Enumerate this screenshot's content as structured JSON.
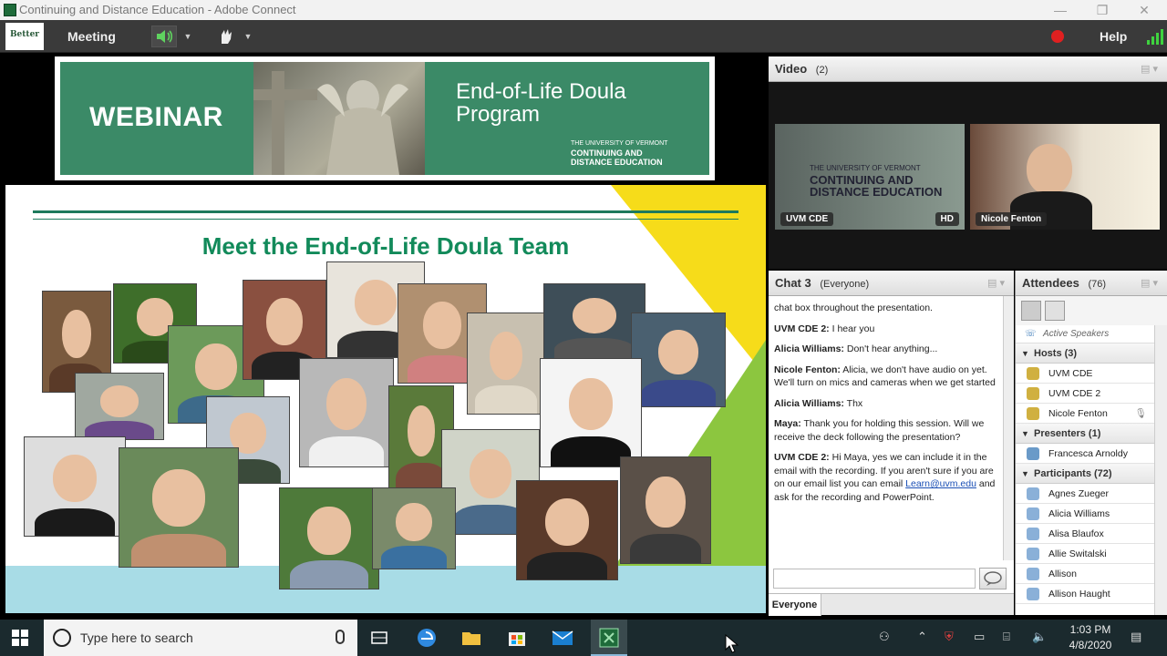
{
  "window": {
    "title": "Continuing and Distance Education - Adobe Connect",
    "minimize_glyph": "—",
    "restore_glyph": "❐",
    "close_glyph": "✕"
  },
  "menubar": {
    "logo_text": "Better",
    "meeting_label": "Meeting",
    "help_label": "Help",
    "icons": [
      "speaker-icon",
      "raise-hand-icon",
      "record-icon",
      "signal-icon"
    ]
  },
  "banner": {
    "webinar": "WEBINAR",
    "title_line1": "End-of-Life Doula",
    "title_line2": "Program",
    "uvm_line1": "THE UNIVERSITY OF VERMONT",
    "uvm_line2": "CONTINUING AND",
    "uvm_line3": "DISTANCE EDUCATION"
  },
  "slide": {
    "heading": "Meet the End-of-Life Doula Team"
  },
  "video_pod": {
    "title": "Video",
    "count": "(2)",
    "feeds": [
      {
        "label": "UVM CDE",
        "badge": "HD",
        "logo_line1": "THE UNIVERSITY OF VERMONT",
        "logo_line2": "CONTINUING AND",
        "logo_line3": "DISTANCE EDUCATION"
      },
      {
        "label": "Nicole Fenton"
      }
    ]
  },
  "chat_pod": {
    "title": "Chat 3",
    "scope": "(Everyone)",
    "messages": [
      {
        "sender": "",
        "text": "chat box throughout the presentation."
      },
      {
        "sender": "UVM CDE 2:",
        "text": " I hear you"
      },
      {
        "sender": "Alicia Williams:",
        "text": " Don't hear anything..."
      },
      {
        "sender": "Nicole Fenton:",
        "text": " Alicia, we don't have audio on yet. We'll turn on mics and cameras when we get started"
      },
      {
        "sender": "Alicia Williams:",
        "text": " Thx"
      },
      {
        "sender": "Maya:",
        "text": " Thank you for holding this session. Will we receive the deck following the presentation?"
      },
      {
        "sender": "UVM CDE 2:",
        "text": " Hi Maya, yes we can include it in the email with the recording. If you aren't sure if you are on our email list you can email ",
        "link": "Learn@uvm.edu",
        "after": " and ask for the recording and PowerPoint."
      }
    ],
    "input_placeholder": "",
    "tab_everyone": "Everyone"
  },
  "attendees_pod": {
    "title": "Attendees",
    "count": "(76)",
    "active_speakers": "Active Speakers",
    "hosts_label": "Hosts (3)",
    "hosts": [
      "UVM CDE",
      "UVM CDE 2",
      "Nicole Fenton"
    ],
    "presenters_label": "Presenters (1)",
    "presenters": [
      "Francesca Arnoldy"
    ],
    "participants_label": "Participants (72)",
    "participants": [
      "Agnes Zueger",
      "Alicia Williams",
      "Alisa Blaufox",
      "Allie Switalski",
      "Allison",
      "Allison Haught"
    ]
  },
  "taskbar": {
    "search_placeholder": "Type here to search",
    "time": "1:03 PM",
    "date": "4/8/2020",
    "pinned": [
      "task-view-icon",
      "edge-icon",
      "file-explorer-icon",
      "store-icon",
      "mail-icon",
      "adobe-connect-icon"
    ]
  },
  "colors": {
    "brand_green": "#3b8a67",
    "heading_green": "#128a5a",
    "record_red": "#e02020",
    "slide_yellow": "#f6dc1a",
    "slide_lime": "#8cc63f",
    "slide_blue": "#a8dce6"
  }
}
